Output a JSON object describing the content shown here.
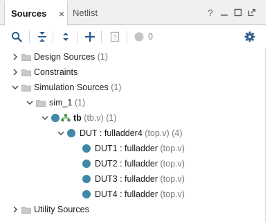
{
  "tabs": {
    "active_label": "Sources",
    "close_glyph": "×",
    "inactive_label": "Netlist"
  },
  "window_controls": {
    "help": "?",
    "minimize": "_",
    "restore": "□",
    "float": "⧉"
  },
  "toolbar": {
    "count": "0",
    "icons": [
      "search-icon",
      "collapse-all-icon",
      "expand-all-icon",
      "add-icon",
      "properties-icon",
      "status-dot-icon",
      "gear-icon"
    ]
  },
  "tree": {
    "design_sources": {
      "name": "Design Sources",
      "count": "(1)"
    },
    "constraints": {
      "name": "Constraints"
    },
    "simulation_sources": {
      "name": "Simulation Sources",
      "count": "(1)"
    },
    "sim_1": {
      "name": "sim_1",
      "count": "(1)"
    },
    "tb": {
      "name": "tb",
      "file": "(tb.v)",
      "count": "(1)"
    },
    "dut": {
      "name": "DUT : fulladder4",
      "file": "(top.v)",
      "count": "(4)"
    },
    "dut1": {
      "name": "DUT1 : fulladder",
      "file": "(top.v)"
    },
    "dut2": {
      "name": "DUT2 : fulladder",
      "file": "(top.v)"
    },
    "dut3": {
      "name": "DUT3 : fulladder",
      "file": "(top.v)"
    },
    "dut4": {
      "name": "DUT4 : fulladder",
      "file": "(top.v)"
    },
    "utility_sources": {
      "name": "Utility Sources"
    }
  },
  "colors": {
    "module_dot": "#3f88a6",
    "folder": "#b8b8b8",
    "accent_blue": "#2d5f8f"
  }
}
